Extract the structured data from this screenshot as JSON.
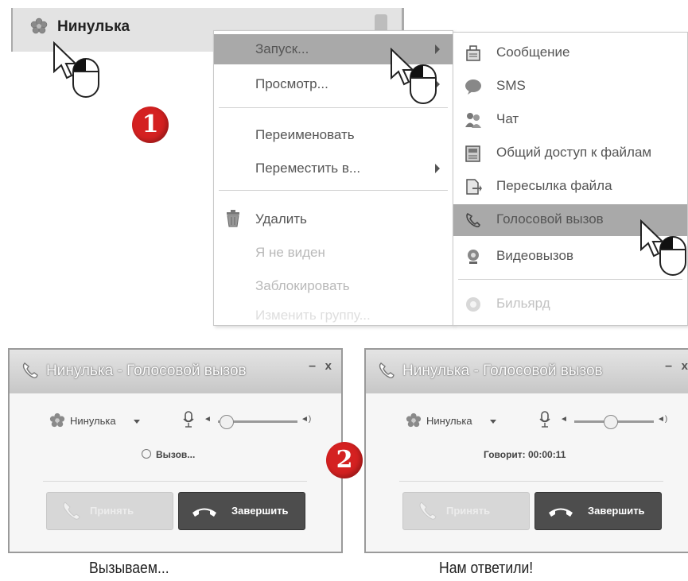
{
  "contact": {
    "name": "Нинулька",
    "icon": "flower-status-icon"
  },
  "context_menu": {
    "items": [
      {
        "label": "Запуск...",
        "submenu": true,
        "highlighted": true
      },
      {
        "label": "Просмотр...",
        "submenu": true
      },
      {
        "label": "Переименовать"
      },
      {
        "label": "Переместить в...",
        "submenu": true
      },
      {
        "label": "Удалить",
        "icon": "trash-icon"
      },
      {
        "label": "Я не виден",
        "disabled": true
      },
      {
        "label": "Заблокировать",
        "disabled": true
      },
      {
        "label": "Изменить группу...",
        "submenu": true,
        "disabled": true
      }
    ]
  },
  "submenu": {
    "items": [
      {
        "label": "Сообщение",
        "icon": "message-icon"
      },
      {
        "label": "SMS",
        "icon": "sms-icon"
      },
      {
        "label": "Чат",
        "icon": "chat-icon"
      },
      {
        "label": "Общий доступ к файлам",
        "icon": "file-share-icon"
      },
      {
        "label": "Пересылка файла",
        "icon": "file-transfer-icon"
      },
      {
        "label": "Голосовой вызов",
        "icon": "voice-call-icon",
        "highlighted": true
      },
      {
        "label": "Видеовызов",
        "icon": "video-call-icon"
      },
      {
        "label": "Бильярд",
        "icon": "billiards-icon",
        "disabled": true
      }
    ]
  },
  "badges": {
    "step1": "1",
    "step2": "2"
  },
  "call_windows": [
    {
      "title": "Нинулька - Голосовой вызов",
      "contact": "Нинулька",
      "status": "Вызов...",
      "answer_label": "Принять",
      "end_label": "Завершить",
      "volume": 0.1
    },
    {
      "title": "Нинулька - Голосовой вызов",
      "contact": "Нинулька",
      "status": "Говорит: 00:00:11",
      "answer_label": "Принять",
      "end_label": "Завершить",
      "volume": 0.45
    }
  ],
  "window_controls": {
    "minimize": "–",
    "close": "x"
  },
  "captions": {
    "left": "Вызываем...",
    "right": "Нам ответили!"
  },
  "colors": {
    "badge": "#d42121",
    "highlight": "#a9a9a9",
    "end_button": "#4d4d4d"
  }
}
